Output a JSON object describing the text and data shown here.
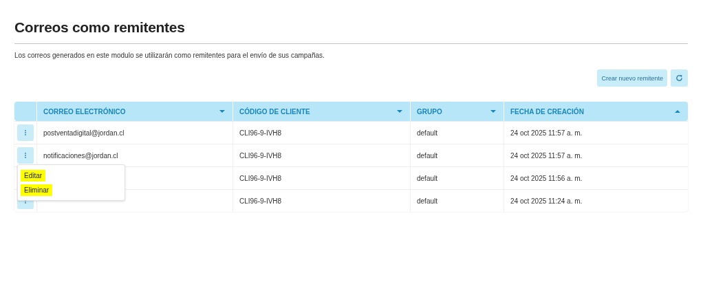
{
  "title": "Correos como remitentes",
  "description": "Los correos generados en este modulo se utilizarán como remitentes para el envío de sus campañas.",
  "toolbar": {
    "create_button": "Crear nuevo remitente"
  },
  "table": {
    "columns": [
      {
        "label": "CORREO ELECTRÓNICO",
        "sort_ascending": false
      },
      {
        "label": "CÓDIGO DE CLIENTE",
        "sort_ascending": false
      },
      {
        "label": "GRUPO",
        "sort_ascending": false
      },
      {
        "label": "FECHA DE CREACIÓN",
        "sort_ascending": true
      }
    ],
    "rows": [
      {
        "email": "postventadigital@jordan.cl",
        "code": "CLI96-9-IVH8",
        "group": "default",
        "date": "24 oct 2025 11:57 a. m."
      },
      {
        "email": "notificaciones@jordan.cl",
        "code": "CLI96-9-IVH8",
        "group": "default",
        "date": "24 oct 2025 11:57 a. m.",
        "menu": [
          {
            "label": "Editar",
            "highlighted": true
          },
          {
            "label": "Eliminar",
            "highlighted": true
          }
        ]
      },
      {
        "code": "CLI96-9-IVH8",
        "group": "default",
        "date": "24 oct 2025 11:56 a. m."
      },
      {
        "code": "CLI96-9-IVH8",
        "group": "default",
        "date": "24 oct 2025 11:24 a. m."
      }
    ]
  }
}
